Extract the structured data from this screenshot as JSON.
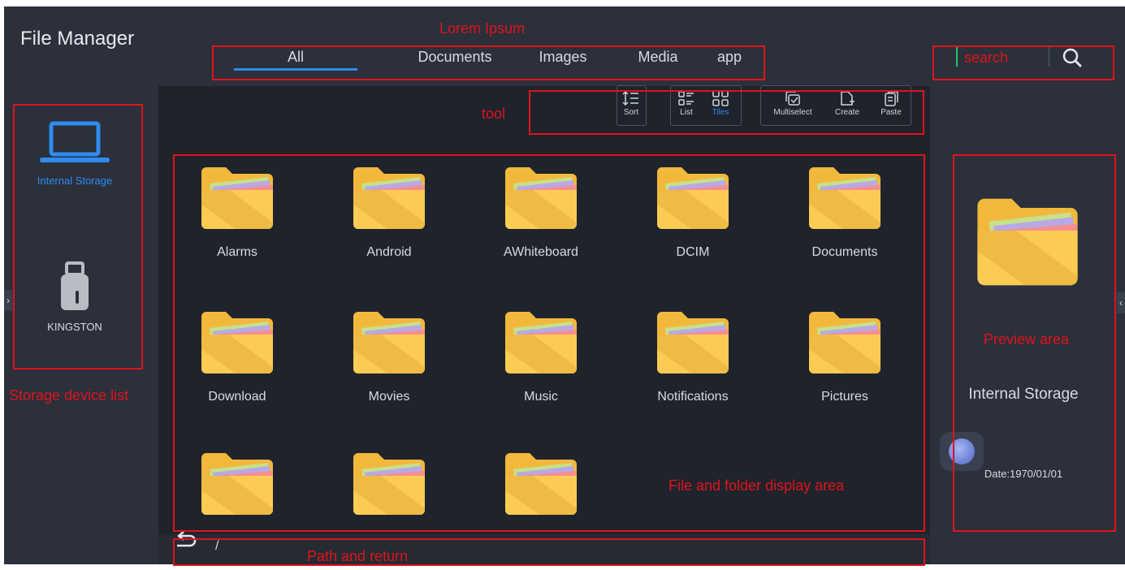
{
  "app": {
    "title": "File Manager"
  },
  "tabs": [
    {
      "label": "All",
      "active": true
    },
    {
      "label": "Documents",
      "active": false
    },
    {
      "label": "Images",
      "active": false
    },
    {
      "label": "Media",
      "active": false
    },
    {
      "label": "app",
      "active": false
    }
  ],
  "search": {
    "placeholder": "search",
    "icon": "search-icon"
  },
  "toolbar": {
    "sort_label": "Sort",
    "list_label": "List",
    "tiles_label": "Tiles",
    "multiselect_label": "Multiselect",
    "create_label": "Create",
    "paste_label": "Paste",
    "active_view": "Tiles"
  },
  "devices": [
    {
      "label": "Internal Storage",
      "icon": "laptop-icon",
      "selected": true
    },
    {
      "label": "KINGSTON",
      "icon": "usb-drive-icon",
      "selected": false
    }
  ],
  "folders": [
    {
      "name": "Alarms"
    },
    {
      "name": "Android"
    },
    {
      "name": "AWhiteboard"
    },
    {
      "name": "DCIM"
    },
    {
      "name": "Documents"
    },
    {
      "name": "Download"
    },
    {
      "name": "Movies"
    },
    {
      "name": "Music"
    },
    {
      "name": "Notifications"
    },
    {
      "name": "Pictures"
    },
    {
      "name": ""
    },
    {
      "name": ""
    },
    {
      "name": ""
    }
  ],
  "preview": {
    "name": "Internal Storage",
    "date": "Date:1970/01/01"
  },
  "path": {
    "current": "/"
  },
  "annotations": {
    "tabs": "Lorem Ipsum",
    "tool": "tool",
    "search": "search",
    "devices": "Storage device list",
    "files": "File and folder display area",
    "preview": "Preview area",
    "path": "Path and return"
  },
  "colors": {
    "accent": "#2f8bf0",
    "annotation": "#e0131c",
    "background": "#1f232c",
    "panel": "#2b303b",
    "folder": "#f7c24a"
  }
}
